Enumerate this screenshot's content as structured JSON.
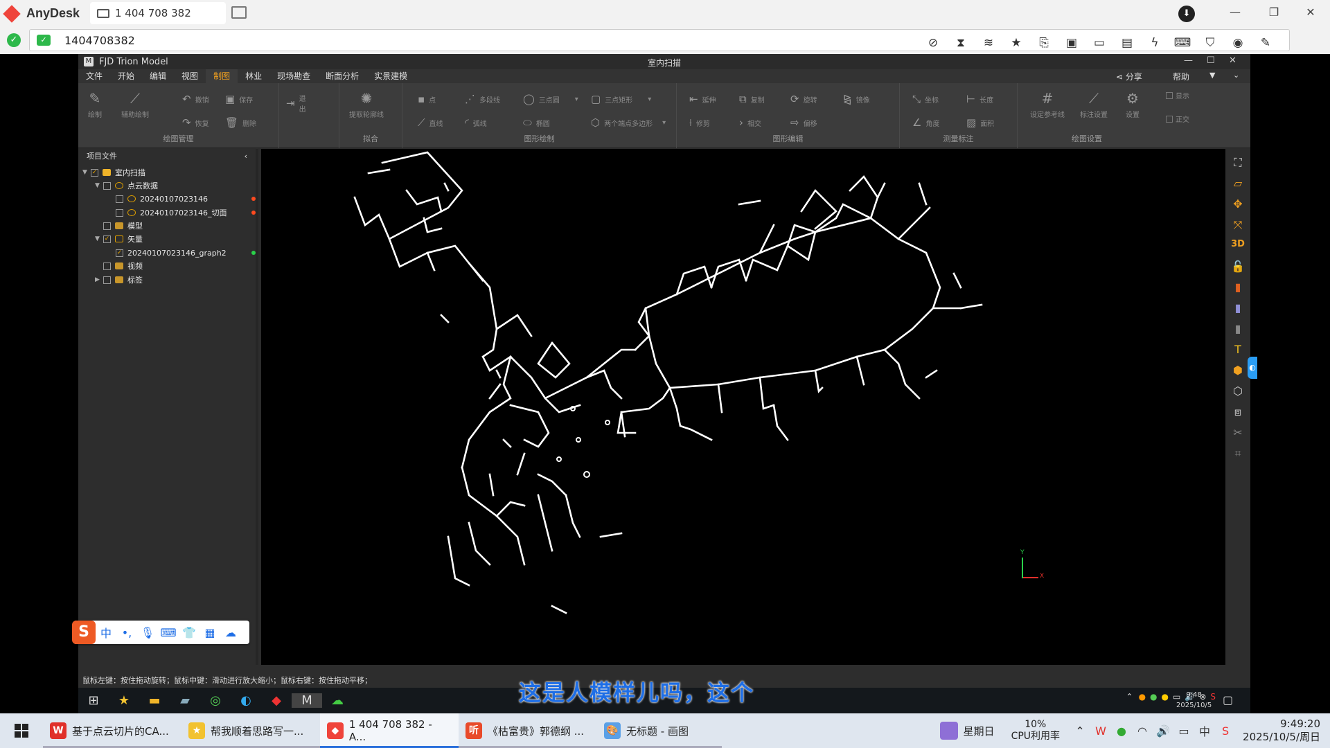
{
  "anydesk": {
    "app_name": "AnyDesk",
    "tab_label": "1 404 708 382",
    "address": "1404708382",
    "toolbar_icons": [
      "screen-off-icon",
      "hourglass-icon",
      "database-icon",
      "star-icon",
      "file-transfer-icon",
      "monitor-1-icon",
      "display-icon",
      "chat-icon",
      "lightning-icon",
      "keyboard-icon",
      "shield-icon",
      "record-icon",
      "pen-icon"
    ]
  },
  "fjd": {
    "app_title": "FJD Trion Model",
    "document_title": "室内扫描",
    "menu": [
      "文件",
      "开始",
      "编辑",
      "视图",
      "制图",
      "林业",
      "现场勘查",
      "断面分析",
      "实景建模"
    ],
    "active_menu": "制图",
    "share_label": "分享",
    "help_label": "帮助",
    "ribbon": {
      "groups": [
        {
          "label": "绘图管理",
          "tools": [
            "绘制",
            "辅助绘制"
          ],
          "small": [
            "撤销",
            "恢复",
            "保存",
            "删除",
            "退出"
          ]
        },
        {
          "label": "拟合",
          "tools": [
            "提取轮廓线"
          ],
          "small": []
        },
        {
          "label": "图形绘制",
          "tools": [],
          "small": [
            "点",
            "多段线",
            "三点圆",
            "三点矩形",
            "直线",
            "弧线",
            "椭圆",
            "两个端点多边形"
          ]
        },
        {
          "label": "图形编辑",
          "tools": [],
          "small": [
            "延伸",
            "复制",
            "旋转",
            "镜像",
            "修剪",
            "相交",
            "偏移"
          ]
        },
        {
          "label": "测量标注",
          "tools": [],
          "small": [
            "坐标",
            "长度",
            "角度",
            "面积"
          ]
        },
        {
          "label": "绘图设置",
          "tools": [
            "设定参考线",
            "标注设置",
            "设置"
          ],
          "small": [
            "显示",
            "正交"
          ]
        }
      ]
    },
    "panel": {
      "title": "项目文件",
      "tree": [
        {
          "label": "室内扫描",
          "checked": true,
          "expanded": true
        },
        {
          "label": "点云数据",
          "checked": false,
          "expanded": true
        },
        {
          "label": "20240107023146",
          "checked": false,
          "status": "#ff4a1f"
        },
        {
          "label": "20240107023146_切面",
          "checked": false,
          "status": "#ff4a1f"
        },
        {
          "label": "模型",
          "checked": false
        },
        {
          "label": "矢量",
          "checked": true,
          "expanded": true
        },
        {
          "label": "20240107023146_graph2",
          "checked": true,
          "status": "#2ad14a"
        },
        {
          "label": "视频",
          "checked": false
        },
        {
          "label": "标签",
          "checked": false,
          "expanded": false
        }
      ]
    },
    "viewport": {
      "axis_y": "Y",
      "axis_x": "X"
    },
    "right_tools": [
      "fit-view-icon",
      "measure-icon",
      "orbit-icon",
      "axis-icon",
      "3d-label",
      "unlock-icon",
      "color-ramp-icon",
      "intensity-icon",
      "height-icon",
      "text-icon",
      "cube-solid-icon",
      "cube-wire-icon",
      "cube-side-icon",
      "clear-icon",
      "crop-icon"
    ],
    "right_tools_3d": "3D",
    "status_text": "鼠标左键：按住拖动旋转；鼠标中键：滑动进行放大缩小；鼠标右键：按住拖动平移；"
  },
  "remote_taskbar": {
    "time": "9:48",
    "date": "2025/10/5"
  },
  "subtitle": "这是人模样儿吗，这个",
  "ime": {
    "logo": "S",
    "lang": "中",
    "punct": "•,"
  },
  "taskbar": {
    "items": [
      {
        "label": "基于点云切片的CA...",
        "icon_color": "#e0302a",
        "icon_text": "W"
      },
      {
        "label": "帮我顺着思路写一...",
        "icon_color": "#f2c230",
        "icon_text": "★"
      },
      {
        "label": "1 404 708 382 - A...",
        "icon_color": "#ef443b",
        "icon_text": "◆",
        "active": true
      },
      {
        "label": "《枯富贵》郭德纲 ...",
        "icon_color": "#e84a2a",
        "icon_text": "听"
      },
      {
        "label": "无标题 - 画图",
        "icon_color": "#5aa0e6",
        "icon_text": "🎨"
      }
    ],
    "weekday": "星期日",
    "cpu_pct": "10%",
    "cpu_label": "CPU利用率",
    "ime_lang": "中",
    "time": "9:49:20",
    "date": "2025/10/5/周日"
  }
}
